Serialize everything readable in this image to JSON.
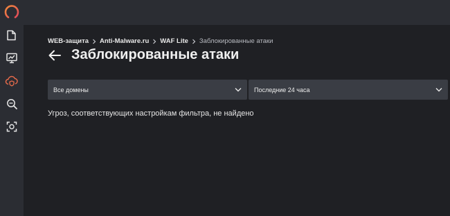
{
  "sidebar": {
    "logo": "app-logo-ring",
    "accent": "#e86b4b",
    "items": [
      {
        "icon": "folder-icon"
      },
      {
        "icon": "monitor-chart-icon"
      },
      {
        "icon": "cloud-shield-icon"
      },
      {
        "icon": "search-scan-icon"
      },
      {
        "icon": "scan-frame-icon"
      }
    ]
  },
  "breadcrumb": {
    "items": [
      "WEB-защита",
      "Anti-Malware.ru",
      "WAF Lite"
    ],
    "current": "Заблокированные атаки"
  },
  "page": {
    "title": "Заблокированные атаки",
    "back_icon": "arrow-left-icon"
  },
  "filters": {
    "domains": {
      "selected": "Все домены"
    },
    "period": {
      "selected": "Последние 24 часа"
    }
  },
  "empty_message": "Угроз, соответствующих настройкам фильтра, не найдено",
  "colors": {
    "background": "#1f2024",
    "panel": "#2b2d33",
    "select_bg": "#3a3d44",
    "text": "#e6e6e6",
    "muted": "#b7b9bf"
  }
}
